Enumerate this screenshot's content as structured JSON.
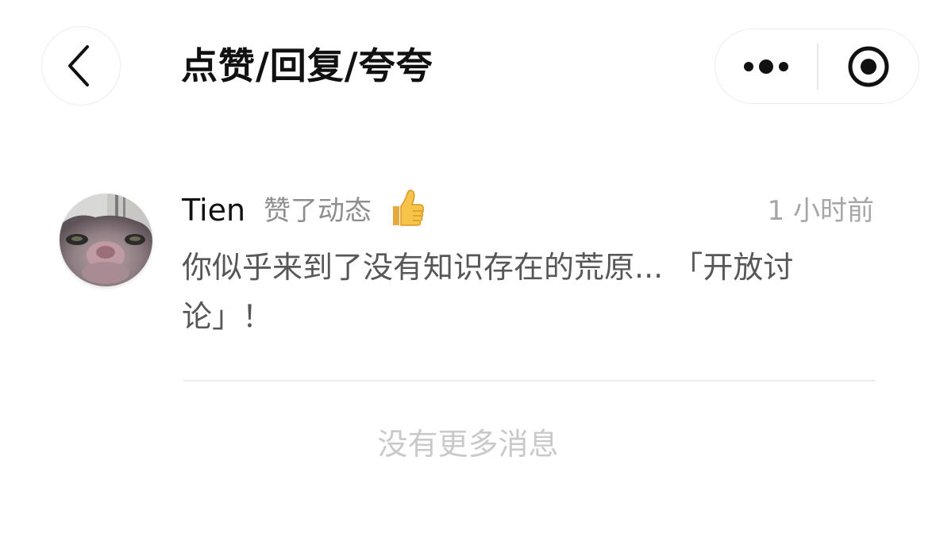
{
  "header": {
    "back_icon": "chevron-left-icon",
    "title": "点赞/回复/夸夸",
    "more_icon": "more-dots-icon",
    "close_icon": "record-target-icon"
  },
  "notification": {
    "avatar": "cat-avatar",
    "user_name": "Tien",
    "action": "赞了动态",
    "action_icon": "thumbs-up-emoji",
    "time": "1 小时前",
    "content": "你似乎来到了没有知识存在的荒原... 「开放讨论」！"
  },
  "footer": {
    "end_text": "没有更多消息"
  },
  "colors": {
    "title": "#111111",
    "secondary_text": "#8e8e8e",
    "body_text": "#575757",
    "muted_text": "#c9c9c9",
    "border": "#ececec"
  }
}
